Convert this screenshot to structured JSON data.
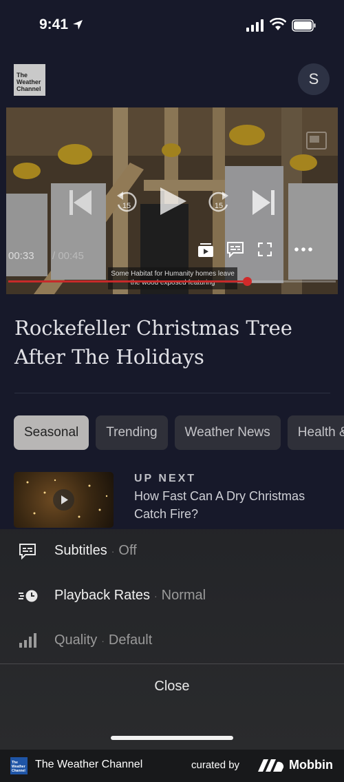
{
  "status": {
    "time": "9:41"
  },
  "header": {
    "logo_text": "The Weather Channel",
    "avatar_initial": "S"
  },
  "video": {
    "current_time": "00:33",
    "total_time": "/ 00:45",
    "caption": "Some Habitat for Humanity homes leave the wood exposed featuring",
    "progress": 0.73,
    "rewind_label": "15",
    "forward_label": "15"
  },
  "title": "Rockefeller Christmas Tree After The Holidays",
  "chips": [
    {
      "label": "Seasonal",
      "active": true
    },
    {
      "label": "Trending",
      "active": false
    },
    {
      "label": "Weather News",
      "active": false
    },
    {
      "label": "Health &",
      "active": false
    }
  ],
  "up_next": {
    "label": "UP NEXT",
    "title": "How Fast Can A Dry Christmas Catch Fire?"
  },
  "sheet": {
    "rows": [
      {
        "label": "Subtitles",
        "value": "Off",
        "icon": "subtitles-icon"
      },
      {
        "label": "Playback Rates",
        "value": "Normal",
        "icon": "playback-rate-icon"
      },
      {
        "label": "Quality",
        "value": "Default",
        "icon": "quality-signal-icon"
      }
    ],
    "separator": "·",
    "close_label": "Close"
  },
  "footer": {
    "app_name": "The Weather Channel",
    "curated_by": "curated by",
    "brand": "Mobbin",
    "logo_text": "The Weather Channel"
  },
  "colors": {
    "background": "#17192a",
    "progress": "#c72a2a",
    "chip_active": "#b8b6b5",
    "sheet": "#2a2b2d"
  }
}
